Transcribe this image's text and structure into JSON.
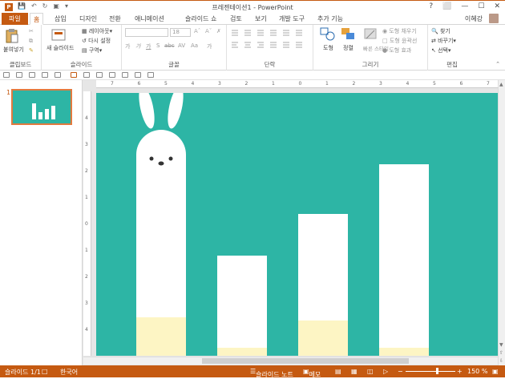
{
  "window": {
    "title": "프레젠테이션1 - PowerPoint",
    "help": "?",
    "controls": [
      "⬜",
      "—",
      "☐",
      "✕"
    ]
  },
  "tabs": {
    "file": "파일",
    "items": [
      "홈",
      "삽입",
      "디자인",
      "전환",
      "애니메이션",
      "슬라이드 쇼",
      "검토",
      "보기",
      "개발 도구",
      "추가 기능"
    ],
    "active": "홈"
  },
  "user": {
    "name": "이혜강"
  },
  "ribbon": {
    "clipboard": {
      "label": "클립보드",
      "paste": "붙여넣기"
    },
    "slides": {
      "label": "슬라이드",
      "new_slide": "새 슬라이드",
      "layout": "레이아웃",
      "reset": "다시 설정",
      "section": "구역"
    },
    "font": {
      "label": "글꼴",
      "font_size": "18",
      "buttons": [
        "가",
        "가",
        "가",
        "S",
        "abc",
        "AV",
        "Aa",
        "가"
      ]
    },
    "paragraph": {
      "label": "단락"
    },
    "drawing": {
      "label": "그리기",
      "shapes": "도형",
      "arrange": "정렬",
      "quick_styles": "빠른 스타일",
      "shape_fill": "도형 채우기",
      "shape_outline": "도형 윤곽선",
      "shape_effects": "도형 효과"
    },
    "editing": {
      "label": "편집",
      "find": "찾기",
      "replace": "바꾸기",
      "select": "선택"
    }
  },
  "slides_panel": {
    "number": "1"
  },
  "hruler_ticks": [
    "7",
    "6",
    "5",
    "4",
    "3",
    "2",
    "1",
    "0",
    "1",
    "2",
    "3",
    "4",
    "5",
    "6",
    "7"
  ],
  "vruler_ticks": [
    "4",
    "3",
    "2",
    "1",
    "0",
    "1",
    "2",
    "3",
    "4"
  ],
  "chart_data": {
    "type": "bar",
    "categories": [
      "",
      "",
      "",
      ""
    ],
    "values": [
      0.86,
      0.38,
      0.54,
      0.73
    ],
    "fill_fraction": [
      0.17,
      0.08,
      0.25,
      0.04
    ],
    "colors": {
      "background": "#2db5a5",
      "bar": "#ffffff",
      "fill": "#fdf5c4"
    },
    "decoration": "rabbit ears on first bar"
  },
  "status": {
    "slide_count": "슬라이드 1/1",
    "language": "한국어",
    "notes": "슬라이드 노트",
    "comments": "메모",
    "zoom": "150 %"
  },
  "colors": {
    "accent": "#c55a11",
    "slide_bg": "#2db5a5"
  }
}
